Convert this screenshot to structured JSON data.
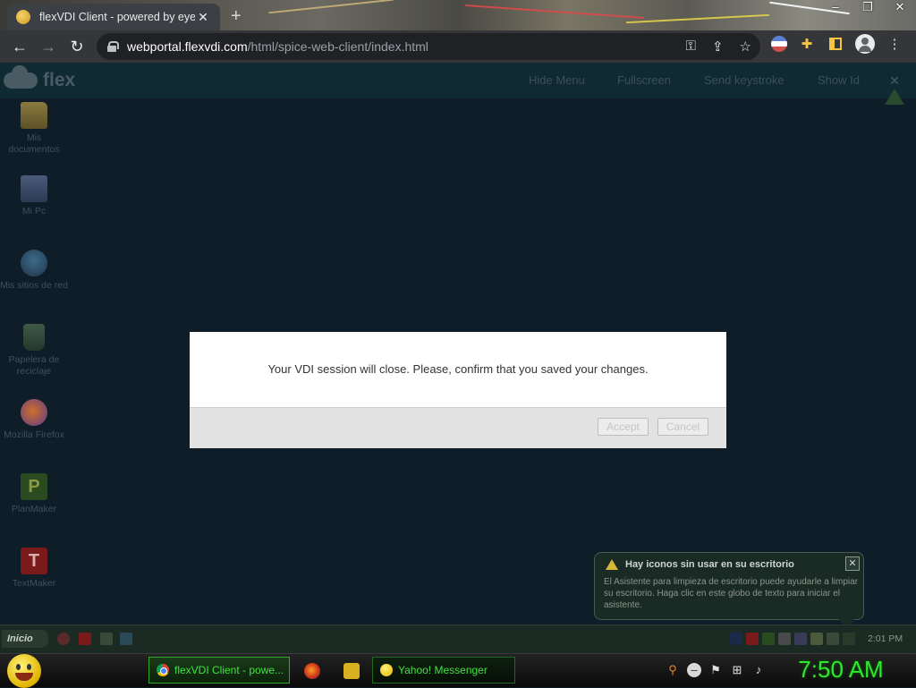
{
  "browser": {
    "tab_title": "flexVDI Client - powered by eyeC",
    "tab_close": "✕",
    "new_tab": "+",
    "window_controls": [
      "–",
      "❐",
      "✕"
    ],
    "url_host": "webportal.flexvdi.com",
    "url_path": "/html/spice-web-client/index.html",
    "nav": {
      "back": "←",
      "forward": "→",
      "reload": "↻"
    },
    "omnibox_icons": [
      "key-icon",
      "share-icon",
      "star-icon"
    ],
    "toolbar_icons": [
      "profile-flag-icon",
      "extensions-puzzle-icon",
      "side-panel-icon",
      "account-avatar-icon",
      "kebab-menu-icon"
    ]
  },
  "flexvdi": {
    "logo_text": "flex",
    "menu": [
      "Hide Menu",
      "Fullscreen",
      "Send keystroke",
      "Show Id"
    ],
    "close_glyph": "✕"
  },
  "desktop_icons": [
    {
      "label": "Mis documentos",
      "icon": "folder-icon"
    },
    {
      "label": "Mi Pc",
      "icon": "computer-icon"
    },
    {
      "label": "Mis sitios de red",
      "icon": "network-places-icon"
    },
    {
      "label": "Papelera de reciclaje",
      "icon": "recycle-bin-icon"
    },
    {
      "label": "Mozilla Firefox",
      "icon": "firefox-icon"
    },
    {
      "label": "PlanMaker",
      "icon": "planmaker-icon",
      "glyph": "P"
    },
    {
      "label": "TextMaker",
      "icon": "textmaker-icon",
      "glyph": "T"
    }
  ],
  "dialog": {
    "message": "Your VDI session will close. Please, confirm that you saved your changes.",
    "accept_label": "Accept",
    "cancel_label": "Cancel"
  },
  "balloon": {
    "title": "Hay iconos sin usar en su escritorio",
    "text": "El Asistente para limpieza de escritorio puede ayudarle a limpiar su escritorio. Haga clic en este globo de texto para iniciar el asistente.",
    "close_glyph": "✕"
  },
  "remote_taskbar": {
    "start_label": "Inicio",
    "clock": "2:01 PM"
  },
  "local_taskbar": {
    "items": [
      {
        "label": "flexVDI Client - powe...",
        "icon": "chrome-icon",
        "active": true
      },
      {
        "label": "Yahoo! Messenger",
        "icon": "yahoo-messenger-icon",
        "active": false
      }
    ],
    "clock": "7:50 AM"
  },
  "colors": {
    "accent_green": "#2ee82e",
    "page_bg": "#0f1d29",
    "dialog_footer": "#e2e2e2"
  }
}
